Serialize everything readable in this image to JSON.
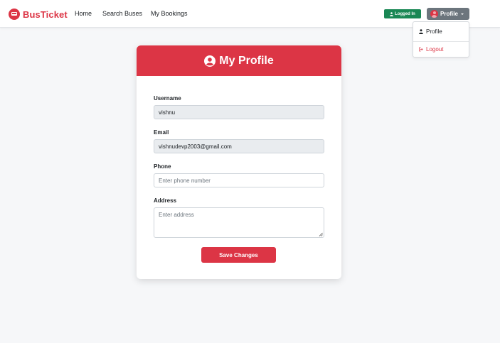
{
  "navbar": {
    "brand": "BusTicket",
    "links": [
      "Home",
      "Search Buses",
      "My Bookings"
    ],
    "status_badge": "Logged In",
    "profile_button": "Profile"
  },
  "dropdown": {
    "items": [
      {
        "label": "Profile",
        "icon": "user-icon"
      },
      {
        "label": "Logout",
        "icon": "logout-icon"
      }
    ]
  },
  "profile_card": {
    "title": "My Profile",
    "fields": {
      "username": {
        "label": "Username",
        "value": "vishnu"
      },
      "email": {
        "label": "Email",
        "value": "vishnudevp2003@gmail.com"
      },
      "phone": {
        "label": "Phone",
        "placeholder": "Enter phone number",
        "value": ""
      },
      "address": {
        "label": "Address",
        "placeholder": "Enter address",
        "value": ""
      }
    },
    "submit_label": "Save Changes"
  },
  "colors": {
    "primary": "#dc3545",
    "success": "#198754",
    "secondary": "#6c757d",
    "background": "#f6f7f9"
  }
}
